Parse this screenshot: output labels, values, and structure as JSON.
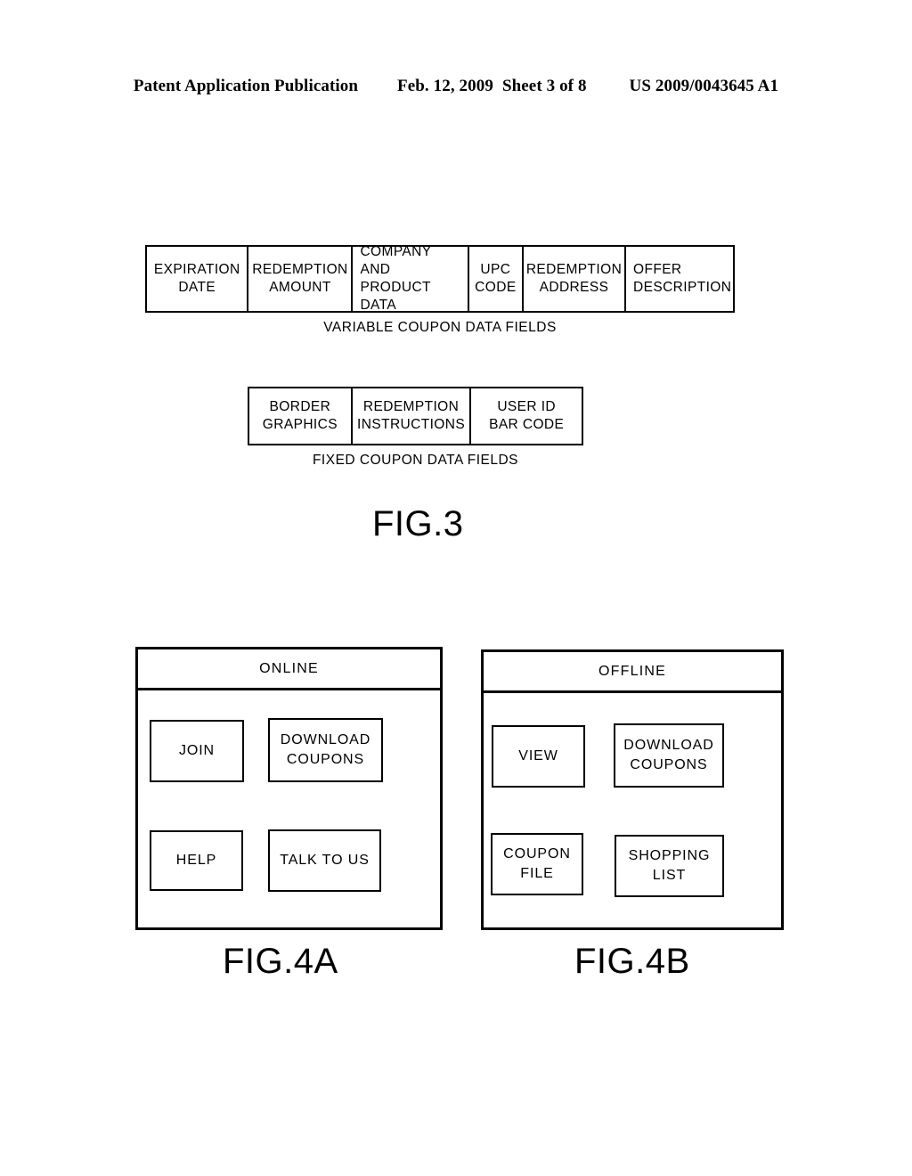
{
  "header": {
    "publication": "Patent Application Publication",
    "date": "Feb. 12, 2009",
    "sheet": "Sheet 3 of 8",
    "patent_number": "US 2009/0043645 A1"
  },
  "fig3": {
    "label": "FIG.3",
    "variable_table": {
      "caption": "VARIABLE COUPON DATA FIELDS",
      "cells": [
        {
          "lines": [
            "EXPIRATION",
            "DATE"
          ],
          "align": "center"
        },
        {
          "lines": [
            "REDEMPTION",
            "AMOUNT"
          ],
          "align": "center"
        },
        {
          "lines": [
            "COMPANY AND",
            "PRODUCT",
            "DATA"
          ],
          "align": "left"
        },
        {
          "lines": [
            "UPC",
            "CODE"
          ],
          "align": "center"
        },
        {
          "lines": [
            "REDEMPTION",
            "ADDRESS"
          ],
          "align": "center"
        },
        {
          "lines": [
            "OFFER",
            "DESCRIPTION"
          ],
          "align": "left"
        }
      ]
    },
    "fixed_table": {
      "caption": "FIXED COUPON DATA FIELDS",
      "cells": [
        {
          "lines": [
            "BORDER",
            "GRAPHICS"
          ],
          "align": "center"
        },
        {
          "lines": [
            "REDEMPTION",
            "INSTRUCTIONS"
          ],
          "align": "center"
        },
        {
          "lines": [
            "USER ID",
            "BAR CODE"
          ],
          "align": "center"
        }
      ]
    }
  },
  "fig4a": {
    "label": "FIG.4A",
    "title": "ONLINE",
    "buttons": [
      {
        "lines": [
          "JOIN"
        ]
      },
      {
        "lines": [
          "DOWNLOAD",
          "COUPONS"
        ]
      },
      {
        "lines": [
          "HELP"
        ]
      },
      {
        "lines": [
          "TALK TO US"
        ]
      }
    ]
  },
  "fig4b": {
    "label": "FIG.4B",
    "title": "OFFLINE",
    "buttons": [
      {
        "lines": [
          "VIEW"
        ]
      },
      {
        "lines": [
          "DOWNLOAD",
          "COUPONS"
        ]
      },
      {
        "lines": [
          "COUPON",
          "FILE"
        ]
      },
      {
        "lines": [
          "SHOPPING",
          "LIST"
        ]
      }
    ]
  }
}
